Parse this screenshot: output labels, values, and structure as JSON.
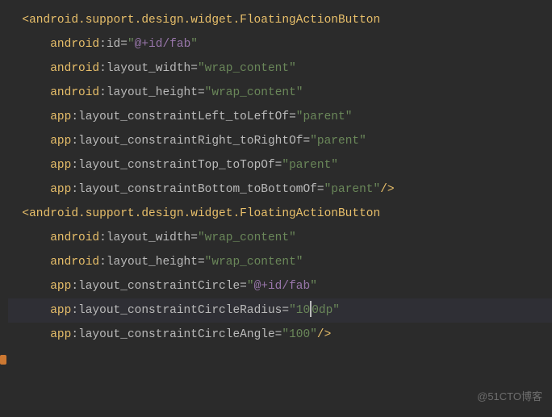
{
  "watermark": "@51CTO博客",
  "lines": [
    {
      "indent": "",
      "parts": [
        {
          "t": "bracket",
          "v": "<"
        },
        {
          "t": "tag-name",
          "v": "android.support.design.widget.FloatingActionButton"
        }
      ]
    },
    {
      "indent": "    ",
      "parts": [
        {
          "t": "ns",
          "v": "android"
        },
        {
          "t": "attr-name",
          "v": ":id="
        },
        {
          "t": "quote",
          "v": "\""
        },
        {
          "t": "ref-value",
          "v": "@+id/fab"
        },
        {
          "t": "quote",
          "v": "\""
        }
      ]
    },
    {
      "indent": "    ",
      "parts": [
        {
          "t": "ns",
          "v": "android"
        },
        {
          "t": "attr-name",
          "v": ":layout_width="
        },
        {
          "t": "quote",
          "v": "\""
        },
        {
          "t": "str-value",
          "v": "wrap_content"
        },
        {
          "t": "quote",
          "v": "\""
        }
      ]
    },
    {
      "indent": "    ",
      "parts": [
        {
          "t": "ns",
          "v": "android"
        },
        {
          "t": "attr-name",
          "v": ":layout_height="
        },
        {
          "t": "quote",
          "v": "\""
        },
        {
          "t": "str-value",
          "v": "wrap_content"
        },
        {
          "t": "quote",
          "v": "\""
        }
      ]
    },
    {
      "indent": "    ",
      "parts": [
        {
          "t": "ns",
          "v": "app"
        },
        {
          "t": "attr-name",
          "v": ":layout_constraintLeft_toLeftOf="
        },
        {
          "t": "quote",
          "v": "\""
        },
        {
          "t": "str-value",
          "v": "parent"
        },
        {
          "t": "quote",
          "v": "\""
        }
      ]
    },
    {
      "indent": "    ",
      "parts": [
        {
          "t": "ns",
          "v": "app"
        },
        {
          "t": "attr-name",
          "v": ":layout_constraintRight_toRightOf="
        },
        {
          "t": "quote",
          "v": "\""
        },
        {
          "t": "str-value",
          "v": "parent"
        },
        {
          "t": "quote",
          "v": "\""
        }
      ]
    },
    {
      "indent": "    ",
      "parts": [
        {
          "t": "ns",
          "v": "app"
        },
        {
          "t": "attr-name",
          "v": ":layout_constraintTop_toTopOf="
        },
        {
          "t": "quote",
          "v": "\""
        },
        {
          "t": "str-value",
          "v": "parent"
        },
        {
          "t": "quote",
          "v": "\""
        }
      ]
    },
    {
      "indent": "    ",
      "parts": [
        {
          "t": "ns",
          "v": "app"
        },
        {
          "t": "attr-name",
          "v": ":layout_constraintBottom_toBottomOf="
        },
        {
          "t": "quote",
          "v": "\""
        },
        {
          "t": "str-value",
          "v": "parent"
        },
        {
          "t": "quote",
          "v": "\""
        },
        {
          "t": "bracket",
          "v": "/>"
        }
      ]
    },
    {
      "blank": true
    },
    {
      "indent": "",
      "parts": [
        {
          "t": "bracket",
          "v": "<"
        },
        {
          "t": "tag-name",
          "v": "android.support.design.widget.FloatingActionButton"
        }
      ]
    },
    {
      "indent": "    ",
      "parts": [
        {
          "t": "ns",
          "v": "android"
        },
        {
          "t": "attr-name",
          "v": ":layout_width="
        },
        {
          "t": "quote",
          "v": "\""
        },
        {
          "t": "str-value",
          "v": "wrap_content"
        },
        {
          "t": "quote",
          "v": "\""
        }
      ]
    },
    {
      "indent": "    ",
      "parts": [
        {
          "t": "ns",
          "v": "android"
        },
        {
          "t": "attr-name",
          "v": ":layout_height="
        },
        {
          "t": "quote",
          "v": "\""
        },
        {
          "t": "str-value",
          "v": "wrap_content"
        },
        {
          "t": "quote",
          "v": "\""
        }
      ]
    },
    {
      "indent": "    ",
      "parts": [
        {
          "t": "ns",
          "v": "app"
        },
        {
          "t": "attr-name",
          "v": ":layout_constraintCircle="
        },
        {
          "t": "quote",
          "v": "\""
        },
        {
          "t": "ref-value",
          "v": "@+id/fab"
        },
        {
          "t": "quote",
          "v": "\""
        }
      ]
    },
    {
      "indent": "    ",
      "highlight": true,
      "parts": [
        {
          "t": "ns",
          "v": "app"
        },
        {
          "t": "attr-name",
          "v": ":layout_constraintCircleRadius="
        },
        {
          "t": "quote",
          "v": "\""
        },
        {
          "t": "str-value",
          "v": "10"
        },
        {
          "t": "cursor",
          "v": ""
        },
        {
          "t": "str-value",
          "v": "0dp"
        },
        {
          "t": "quote",
          "v": "\""
        }
      ]
    },
    {
      "indent": "    ",
      "parts": [
        {
          "t": "ns",
          "v": "app"
        },
        {
          "t": "attr-name",
          "v": ":layout_constraintCircleAngle="
        },
        {
          "t": "quote",
          "v": "\""
        },
        {
          "t": "str-value",
          "v": "100"
        },
        {
          "t": "quote",
          "v": "\""
        },
        {
          "t": "bracket",
          "v": "/>"
        }
      ]
    }
  ]
}
